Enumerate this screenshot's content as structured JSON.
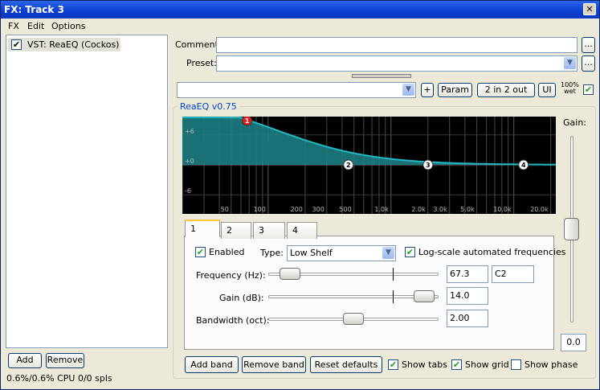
{
  "window": {
    "title": "FX: Track 3",
    "close_glyph": "✕"
  },
  "menu": {
    "items": [
      "FX",
      "Edit",
      "Options"
    ]
  },
  "fx_list": {
    "items": [
      {
        "label": "VST: ReaEQ (Cockos)",
        "checked": true
      }
    ]
  },
  "bottom_left": {
    "add_label": "Add",
    "remove_label": "Remove",
    "cpu_text": "0.6%/0.6% CPU 0/0 spls"
  },
  "header": {
    "comment_label": "Comment:",
    "comment_value": "",
    "comment_more": "...",
    "preset_label": "Preset:",
    "preset_value": "",
    "preset_more": "..."
  },
  "param_bar": {
    "select_value": "",
    "plus_label": "+",
    "param_label": "Param",
    "io_label": "2 in 2 out",
    "ui_label": "UI",
    "wet_line1": "100%",
    "wet_line2": "wet",
    "wet_checked": true
  },
  "plugin": {
    "group_title": "ReaEQ v0.75",
    "gain_label": "Gain:",
    "gain_value": "0.0",
    "gain_level_fraction": 0.5
  },
  "graph": {
    "db_labels": [
      "+6",
      "+0",
      "-6"
    ],
    "freq_labels": [
      "50",
      "100",
      "200",
      "300",
      "500",
      "1.0k",
      "2.0k",
      "3.0k",
      "5.0k",
      "10.0k",
      "20.0k"
    ],
    "band_markers": [
      "1",
      "2",
      "3",
      "4"
    ],
    "colors": {
      "background": "#000000",
      "curve": "#21b9c6",
      "fill": "#1d7d82",
      "marker_active": "#e02020"
    }
  },
  "tabs": {
    "items": [
      "1",
      "2",
      "3",
      "4"
    ],
    "active_index": 0
  },
  "band": {
    "enabled_label": "Enabled",
    "enabled_checked": true,
    "type_label": "Type:",
    "type_value": "Low Shelf",
    "logscale_label": "Log-scale automated frequencies",
    "logscale_checked": true,
    "freq_label": "Frequency (Hz):",
    "freq_value": "67.3",
    "freq_note": "C2",
    "gain_label": "Gain (dB):",
    "gain_value": "14.0",
    "bw_label": "Bandwidth (oct):",
    "bw_value": "2.00"
  },
  "bottom_controls": {
    "add_band": "Add band",
    "remove_band": "Remove band",
    "reset_defaults": "Reset defaults",
    "show_tabs": "Show tabs",
    "show_tabs_checked": true,
    "show_grid": "Show grid",
    "show_grid_checked": true,
    "show_phase": "Show phase",
    "show_phase_checked": false
  }
}
